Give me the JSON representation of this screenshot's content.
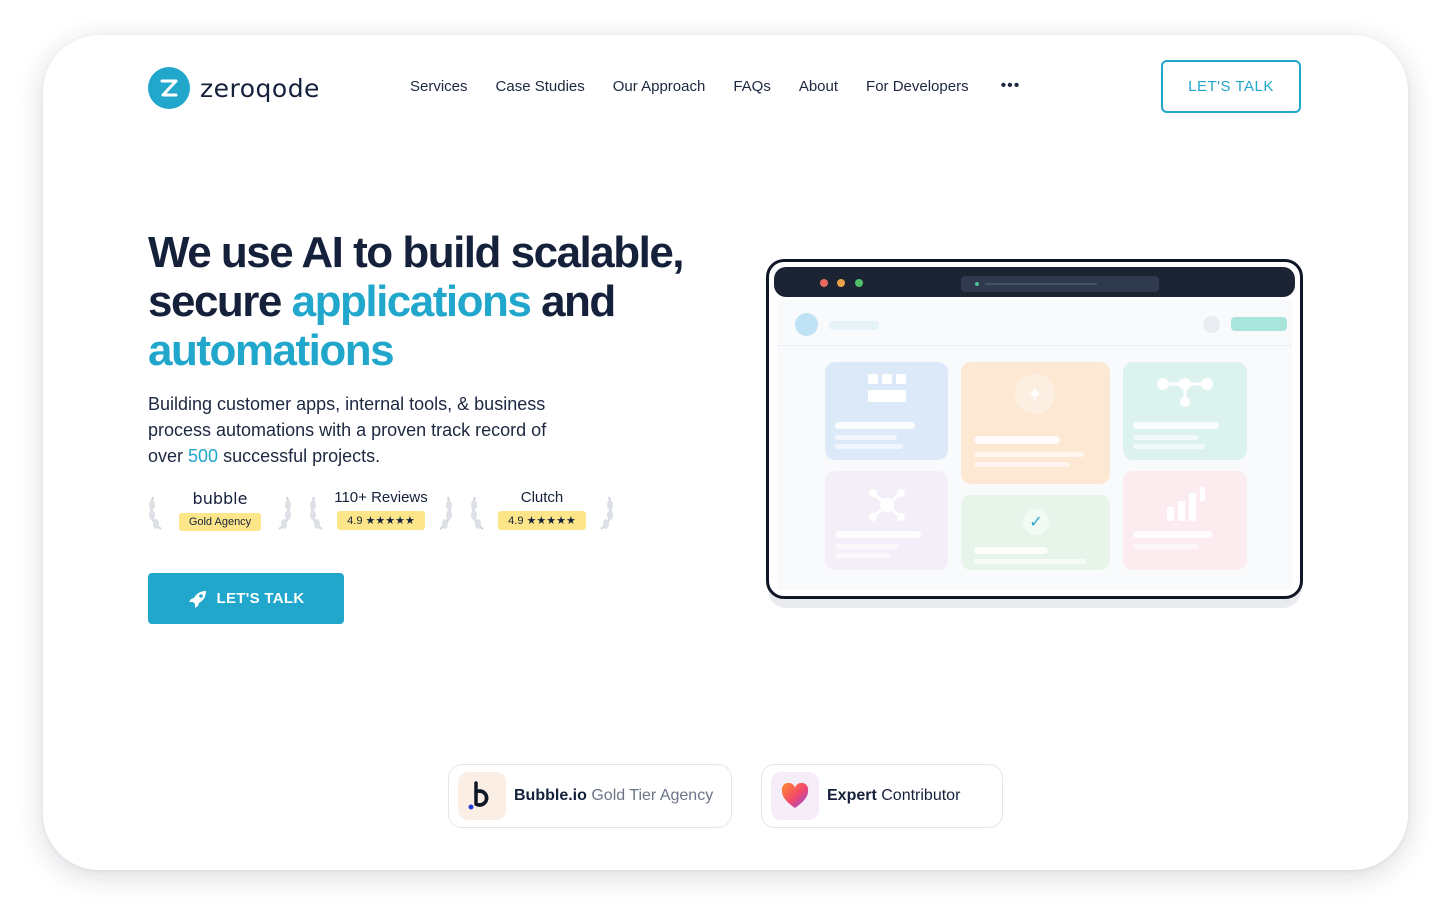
{
  "brand": {
    "name": "zeroqode",
    "logo_color": "#21a6cc"
  },
  "nav": {
    "items": [
      "Services",
      "Case Studies",
      "Our Approach",
      "FAQs",
      "About",
      "For Developers"
    ],
    "more_label": "•••",
    "cta_label": "LET'S TALK"
  },
  "hero": {
    "headline": {
      "line1": "We use AI to build scalable,",
      "line2_prefix": "secure",
      "line2_accent": "applications",
      "line2_suffix": "and",
      "line3_accent": "automations"
    },
    "subtitle": {
      "line1": "Building customer apps, internal tools, & business",
      "line2": "process automations with a proven track record of",
      "line3_prefix": "over",
      "line3_highlight": "500",
      "line3_suffix": "successful projects."
    },
    "badges": [
      {
        "title": "bubble",
        "pill": "Gold Agency"
      },
      {
        "title": "110+ Reviews",
        "pill": "4.9 ★★★★★"
      },
      {
        "title": "Clutch",
        "pill": "4.9 ★★★★★"
      }
    ],
    "cta_label": "LET'S TALK"
  },
  "mockup": {
    "icon": "browser-window-icon",
    "cards": [
      {
        "icon": "grid-icon",
        "color": "#dbe9f8"
      },
      {
        "icon": "sparkle-icon",
        "color": "#fde8d4"
      },
      {
        "icon": "network-icon",
        "color": "#dcf2ee"
      },
      {
        "icon": "molecule-icon",
        "color": "#f4eef8"
      },
      {
        "icon": "check-icon",
        "color": "#e6f4ea"
      },
      {
        "icon": "bar-chart-icon",
        "color": "#fcebef"
      }
    ]
  },
  "credentials": [
    {
      "icon": "bubble-logo-icon",
      "strong": "Bubble.io",
      "muted": "Gold Tier Agency"
    },
    {
      "icon": "heart-logo-icon",
      "strong": "Expert",
      "muted": "Contributor"
    }
  ],
  "colors": {
    "accent": "#21a6cc",
    "dark": "#15213b",
    "gold": "#fde58a"
  }
}
